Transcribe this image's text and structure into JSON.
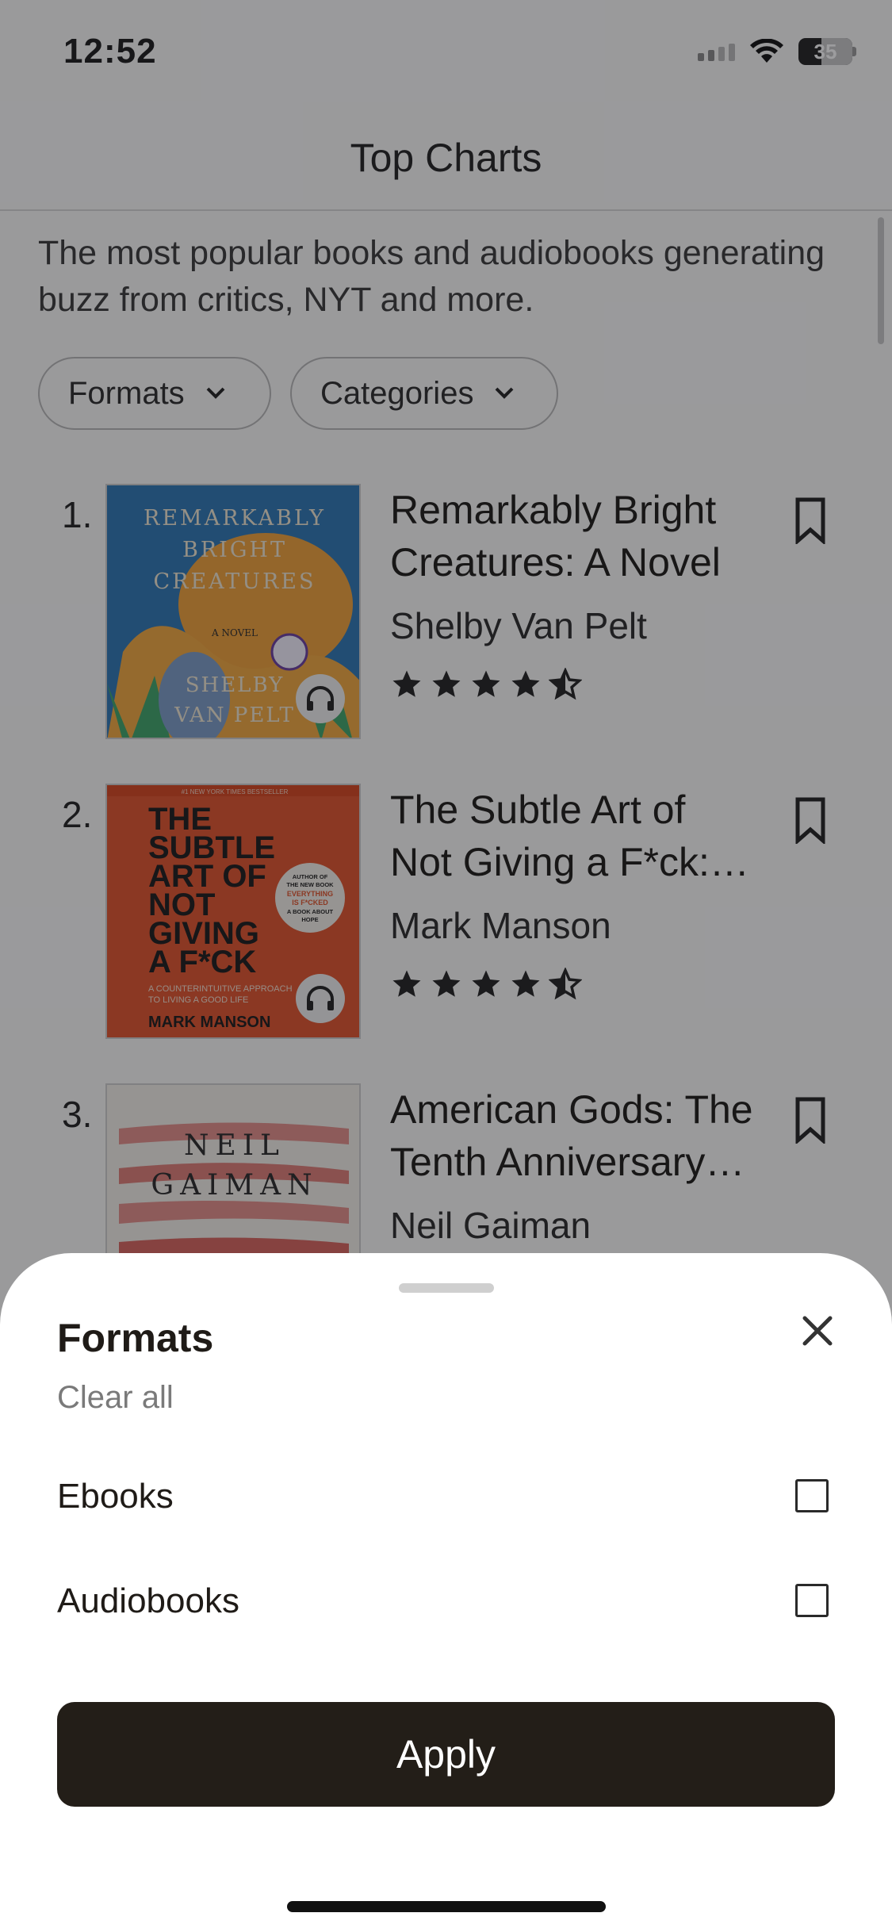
{
  "status_bar": {
    "time": "12:52",
    "battery": "35"
  },
  "header": {
    "title": "Top Charts"
  },
  "intro": {
    "text": "The most popular books and audiobooks generating buzz from critics, NYT and more."
  },
  "filters": {
    "formats_label": "Formats",
    "categories_label": "Categories"
  },
  "books": [
    {
      "rank": "1.",
      "title_line1": "Remarkably Bright",
      "title_line2": "Creatures: A Novel",
      "author": "Shelby Van Pelt",
      "rating": 4.5,
      "cover": {
        "line1": "REMARKABLY",
        "line2": "BRIGHT",
        "line3": "CREATURES",
        "subtitle": "A NOVEL",
        "author1": "SHELBY",
        "author2": "VAN PELT"
      }
    },
    {
      "rank": "2.",
      "title_line1": "The Subtle Art of",
      "title_line2": "Not Giving a F*ck:…",
      "author": "Mark Manson",
      "rating": 4.5,
      "cover": {
        "banner": "#1 NEW YORK TIMES BESTSELLER",
        "l1": "THE",
        "l2": "SUBTLE",
        "l3": "ART OF",
        "l4": "NOT",
        "l5": "GIVING",
        "l6": "A F*CK",
        "sticker1": "AUTHOR OF",
        "sticker2": "THE NEW BOOK",
        "sticker3": "EVERYTHING",
        "sticker4": "IS F*CKED",
        "sticker5": "A BOOK ABOUT",
        "sticker6": "HOPE",
        "tagline1": "A COUNTERINTUITIVE APPROACH",
        "tagline2": "TO LIVING A GOOD LIFE",
        "author": "MARK MANSON"
      }
    },
    {
      "rank": "3.",
      "title_line1": "American Gods: The",
      "title_line2": "Tenth Anniversary…",
      "author": "Neil Gaiman",
      "cover": {
        "line1": "NEIL",
        "line2": "GAIMAN"
      }
    }
  ],
  "sheet": {
    "title": "Formats",
    "clear_all": "Clear all",
    "options": [
      {
        "label": "Ebooks",
        "checked": false
      },
      {
        "label": "Audiobooks",
        "checked": false
      }
    ],
    "apply_label": "Apply"
  },
  "colors": {
    "accent_dark": "#231e18",
    "overlay": "rgba(20,20,25,0.42)"
  }
}
